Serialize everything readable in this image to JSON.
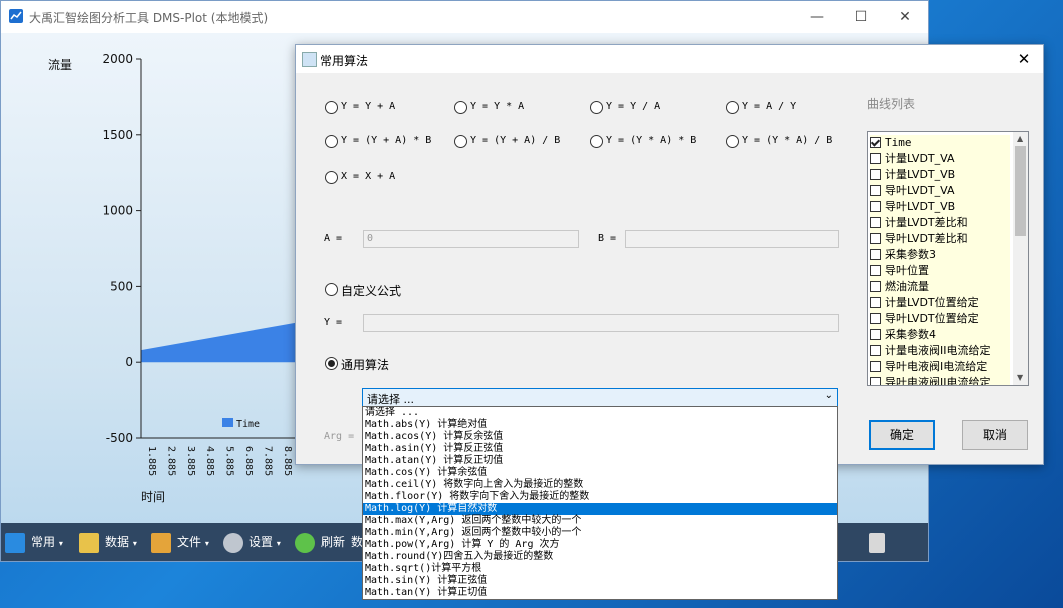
{
  "app": {
    "title": "大禹汇智绘图分析工具 DMS-Plot (本地模式)",
    "controls": {
      "minimize": "—",
      "maximize": "☐",
      "close": "✕"
    }
  },
  "chart_data": {
    "type": "area",
    "ylabel": "流量",
    "xlabel": "时间",
    "yticks": [
      "2000",
      "1500",
      "1000",
      "500",
      "0",
      "-500"
    ],
    "xticks": [
      "1.885",
      "2.885",
      "3.885",
      "4.885",
      "5.885",
      "6.885",
      "7.885",
      "8.885"
    ],
    "ylim": [
      -500,
      2000
    ],
    "series": [
      {
        "name": "Time",
        "color": "#3b82e6",
        "x": [
          1.885,
          8.885
        ],
        "y": [
          80,
          260
        ]
      }
    ],
    "legend": "Time",
    "grid": false
  },
  "toolbar": {
    "items": [
      {
        "label": "常用",
        "icon": "book-icon",
        "color": "#2a8be0"
      },
      {
        "label": "数据",
        "icon": "data-icon",
        "color": "#e8c24a"
      },
      {
        "label": "文件",
        "icon": "files-icon",
        "color": "#e4a43a"
      },
      {
        "label": "设置",
        "icon": "gear-icon",
        "color": "#bfc6cf"
      },
      {
        "label": "刷新",
        "icon": "refresh-icon",
        "color": "#5ec24a"
      },
      {
        "label": "数",
        "icon": "",
        "color": ""
      }
    ]
  },
  "dialog": {
    "title": "常用算法",
    "close": "✕",
    "formulas": [
      "Y = Y + A",
      "Y = Y * A",
      "Y = Y / A",
      "Y = A / Y",
      "Y = (Y + A) * B",
      "Y = (Y + A) / B",
      "Y = (Y * A) * B",
      "Y = (Y * A) / B",
      "X = X + A"
    ],
    "a_label": "A =",
    "a_value": "0",
    "b_label": "B =",
    "b_value": "",
    "custom_label": "自定义公式",
    "y_label": "Y =",
    "general_label": "通用算法",
    "arg_label": "Arg =",
    "combo_value": "请选择 ...",
    "dropdown": [
      "请选择 ...",
      "Math.abs(Y) 计算绝对值",
      "Math.acos(Y) 计算反余弦值",
      "Math.asin(Y) 计算反正弦值",
      "Math.atan(Y) 计算反正切值",
      "Math.cos(Y) 计算余弦值",
      "Math.ceil(Y) 将数字向上舍入为最接近的整数",
      "Math.floor(Y) 将数字向下舍入为最接近的整数",
      "Math.log(Y) 计算自然对数",
      "Math.max(Y,Arg) 返回两个整数中较大的一个",
      "Math.min(Y,Arg) 返回两个整数中较小的一个",
      "Math.pow(Y,Arg) 计算 Y 的 Arg 次方",
      "Math.round(Y)四舍五入为最接近的整数",
      "Math.sqrt()计算平方根",
      "Math.sin(Y) 计算正弦值",
      "Math.tan(Y) 计算正切值"
    ],
    "dropdown_selected_index": 8,
    "curve_list_title": "曲线列表",
    "curves": [
      {
        "label": "Time",
        "checked": true
      },
      {
        "label": "计量LVDT_VA",
        "checked": false
      },
      {
        "label": "计量LVDT_VB",
        "checked": false
      },
      {
        "label": "导叶LVDT_VA",
        "checked": false
      },
      {
        "label": "导叶LVDT_VB",
        "checked": false
      },
      {
        "label": "计量LVDT差比和",
        "checked": false
      },
      {
        "label": "导叶LVDT差比和",
        "checked": false
      },
      {
        "label": "采集参数3",
        "checked": false
      },
      {
        "label": "导叶位置",
        "checked": false
      },
      {
        "label": "燃油流量",
        "checked": false
      },
      {
        "label": "计量LVDT位置给定",
        "checked": false
      },
      {
        "label": "导叶LVDT位置给定",
        "checked": false
      },
      {
        "label": "采集参数4",
        "checked": false
      },
      {
        "label": "计量电液阀II电流给定",
        "checked": false
      },
      {
        "label": "导叶电液阀Ⅰ电流给定",
        "checked": false
      },
      {
        "label": "导叶电液阀II电流给定",
        "checked": false
      }
    ],
    "ok_label": "确定",
    "cancel_label": "取消"
  }
}
